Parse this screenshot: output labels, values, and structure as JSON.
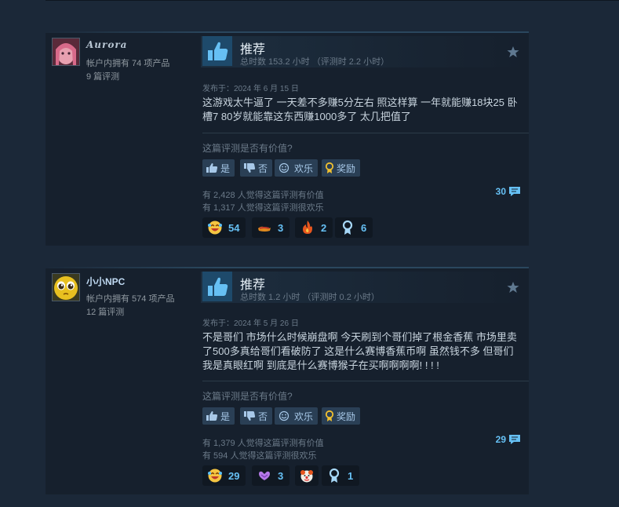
{
  "reviews": [
    {
      "author_name": "Aurora",
      "products_owned": "帐户内拥有 74 项产品",
      "reviews_count": "9 篇评测",
      "verdict": "推荐",
      "hours": "总时数 153.2 小时 （评测时 2.2 小时）",
      "posted": "发布于：2024 年 6 月 15 日",
      "content": "这游戏太牛逼了 一天差不多赚5分左右 照这样算 一年就能赚18块25 卧槽7 80岁就能靠这东西赚1000多了 太几把值了",
      "helpful_question": "这篇评测是否有价值?",
      "buttons": {
        "yes": "是",
        "no": "否",
        "funny": "欢乐",
        "award": "奖励"
      },
      "helpful_count": "有 2,428 人觉得这篇评测有价值",
      "funny_count": "有 1,317 人觉得这篇评测很欢乐",
      "comment_count": "30",
      "awards": [
        {
          "icon": "laughing-face-icon",
          "count": "54"
        },
        {
          "icon": "hotdog-icon",
          "count": "3"
        },
        {
          "icon": "fire-icon",
          "count": "2"
        },
        {
          "icon": "ribbon-icon",
          "count": "6"
        }
      ]
    },
    {
      "author_name": "小小NPC",
      "products_owned": "帐户内拥有 574 项产品",
      "reviews_count": "12 篇评测",
      "verdict": "推荐",
      "hours": "总时数 1.2 小时 （评测时 0.2 小时）",
      "posted": "发布于：2024 年 5 月 26 日",
      "content": "不是哥们 市场什么时候崩盘啊 今天刷到个哥们掉了根金香蕉 市场里卖了500多真给哥们看破防了 这是什么赛博香蕉币啊 虽然钱不多 但哥们我是真眼红啊 到底是什么赛博猴子在买啊啊啊啊! ! ! !",
      "helpful_question": "这篇评测是否有价值?",
      "buttons": {
        "yes": "是",
        "no": "否",
        "funny": "欢乐",
        "award": "奖励"
      },
      "helpful_count": "有 1,379 人觉得这篇评测有价值",
      "funny_count": "有 594 人觉得这篇评测很欢乐",
      "comment_count": "29",
      "awards": [
        {
          "icon": "laughing-face-icon",
          "count": "29"
        },
        {
          "icon": "heart-hands-icon",
          "count": "3"
        },
        {
          "icon": "clown-face-icon",
          "count": ""
        },
        {
          "icon": "ribbon-icon",
          "count": "1"
        }
      ]
    }
  ],
  "colors": {
    "background": "#1b2838",
    "card": "#16202d",
    "accent": "#66c0f4",
    "button": "#2a3f55",
    "award_gold": "#f0c030"
  }
}
